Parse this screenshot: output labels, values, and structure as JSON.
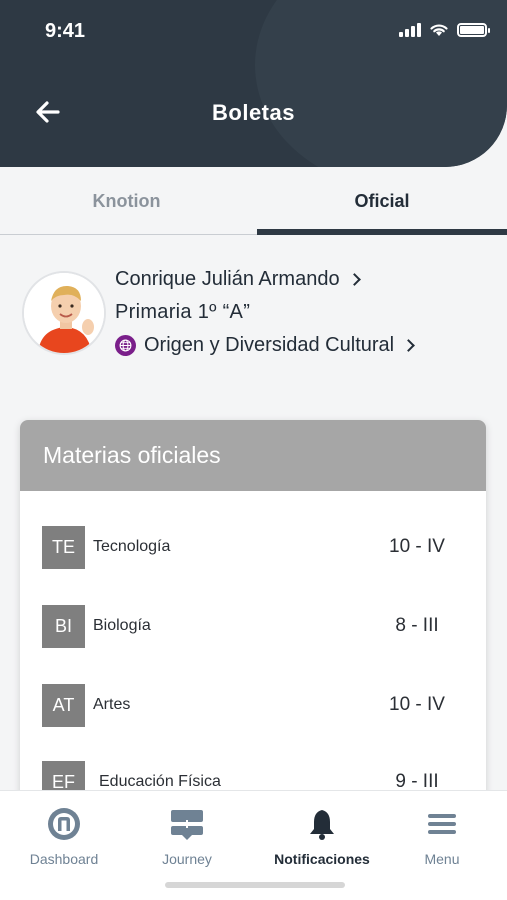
{
  "status_bar": {
    "time": "9:41"
  },
  "header": {
    "title": "Boletas"
  },
  "tabs": [
    {
      "label": "Knotion",
      "active": false
    },
    {
      "label": "Oficial",
      "active": true
    }
  ],
  "student": {
    "name": "Conrique Julián Armando",
    "grade": "Primaria  1º  “A”",
    "program": "Origen y Diversidad Cultural",
    "program_icon_color": "#7a1f8a"
  },
  "card": {
    "title": "Materias oficiales",
    "subjects": [
      {
        "code": "TE",
        "name": "Tecnología",
        "grade": "10 - IV"
      },
      {
        "code": "BI",
        "name": "Biología",
        "grade": "8 - III"
      },
      {
        "code": "AT",
        "name": "Artes",
        "grade": "10 - IV"
      },
      {
        "code": "EF",
        "name": "Educación Física",
        "grade": "9 - III"
      }
    ]
  },
  "bottom_nav": [
    {
      "label": "Dashboard",
      "icon": "dashboard-icon",
      "active": false
    },
    {
      "label": "Journey",
      "icon": "journey-icon",
      "active": false
    },
    {
      "label": "Notificaciones",
      "icon": "bell-icon",
      "active": true
    },
    {
      "label": "Menu",
      "icon": "menu-icon",
      "active": false
    }
  ],
  "colors": {
    "header_bg": "#2e3944",
    "accent": "#2e3944",
    "nav_inactive": "#6f8294"
  }
}
